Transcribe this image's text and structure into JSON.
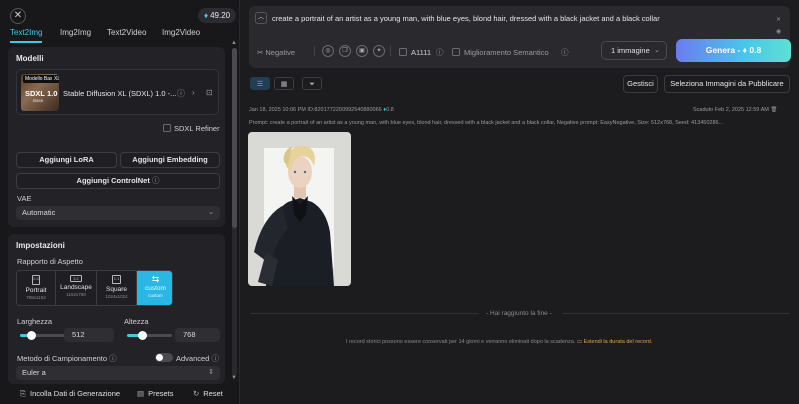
{
  "header": {
    "close_glyph": "✕",
    "credits": "49.20",
    "tabs": [
      "Text2Img",
      "Img2Img",
      "Text2Video",
      "Img2Video"
    ]
  },
  "models": {
    "title": "Modelli",
    "thumb_badge_base": "Modello Base",
    "thumb_badge_xl": "XL",
    "thumb_title": "SDXL 1.0",
    "thumb_sub": "Base",
    "model_name": "Stable Diffusion XL (SDXL) 1.0 -...",
    "refiner_label": "SDXL Refiner",
    "refiner_checked": false,
    "add_lora": "Aggiungi LoRA",
    "add_embedding": "Aggiungi Embedding",
    "add_controlnet": "Aggiungi ControlNet",
    "vae_label": "VAE",
    "vae_value": "Automatic"
  },
  "settings": {
    "title": "Impostazioni",
    "aspect_label": "Rapporto di Aspetto",
    "ratios": [
      {
        "label": "Portrait",
        "size": "768x1152",
        "icon": "2:3"
      },
      {
        "label": "Landscape",
        "size": "1152x768",
        "icon": "3:2"
      },
      {
        "label": "Square",
        "size": "1024x1024",
        "icon": "1:1"
      },
      {
        "label": "custom",
        "size": "custom",
        "icon": "⇆"
      }
    ],
    "active_ratio": "custom",
    "width_label": "Larghezza",
    "width_value": "512",
    "width_fraction": 0.25,
    "height_label": "Altezza",
    "height_value": "768",
    "height_fraction": 0.35,
    "sampling_label": "Metodo di Campionamento",
    "advanced_label": "Advanced",
    "advanced_on": false,
    "sampler_value": "Euler a"
  },
  "bottom_bar": {
    "paste": "Incolla Dati di Generazione",
    "presets": "Presets",
    "reset": "Reset"
  },
  "prompt": {
    "text": "create a portrait of an artist as a young man, with blue eyes, blond hair, dressed with a black jacket and a black collar",
    "negative_label": "Negative",
    "a1111_label": "A1111",
    "semantic_label": "Miglioramento Semantico",
    "image_count": "1 immagine",
    "generate_label": "Genera",
    "generate_cost": "0.8"
  },
  "results": {
    "manage_label": "Gestisci",
    "select_publish_label": "Seleziona Immagini da Pubblicare",
    "record_date": "Jan 18, 2025 10:06 PM",
    "record_id": "ID:8201772200992540880066",
    "record_cost": "0.8",
    "expiry": "Scaduto Feb 2, 2025 12:59 AM",
    "record_prompt": "Prompt: create a portrait of an artist as a young man, with blue eyes, blond hair, dressed with a black jacket and a black collar, Negative prompt: EasyNegative, Size: 512x768, Seed: 413450286...",
    "end_text": "- Hai raggiunto la fine -",
    "retention_text": "I record storici possono essere conservati per 14 giorni e verranno eliminati dopo la scadenza.",
    "retention_link": "Estendi la durata del record."
  },
  "colors": {
    "accent": "#3ec7e6",
    "background": "#1c1c1e",
    "panel": "#232327"
  }
}
